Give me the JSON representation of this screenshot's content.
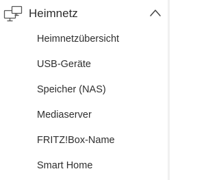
{
  "menu": {
    "header": {
      "icon": "network-devices-icon",
      "label": "Heimnetz",
      "chevron": "chevron-up-icon",
      "expanded": true
    },
    "items": [
      {
        "label": "Heimnetzübersicht"
      },
      {
        "label": "USB-Geräte"
      },
      {
        "label": "Speicher (NAS)"
      },
      {
        "label": "Mediaserver"
      },
      {
        "label": "FRITZ!Box-Name"
      },
      {
        "label": "Smart Home"
      }
    ]
  }
}
